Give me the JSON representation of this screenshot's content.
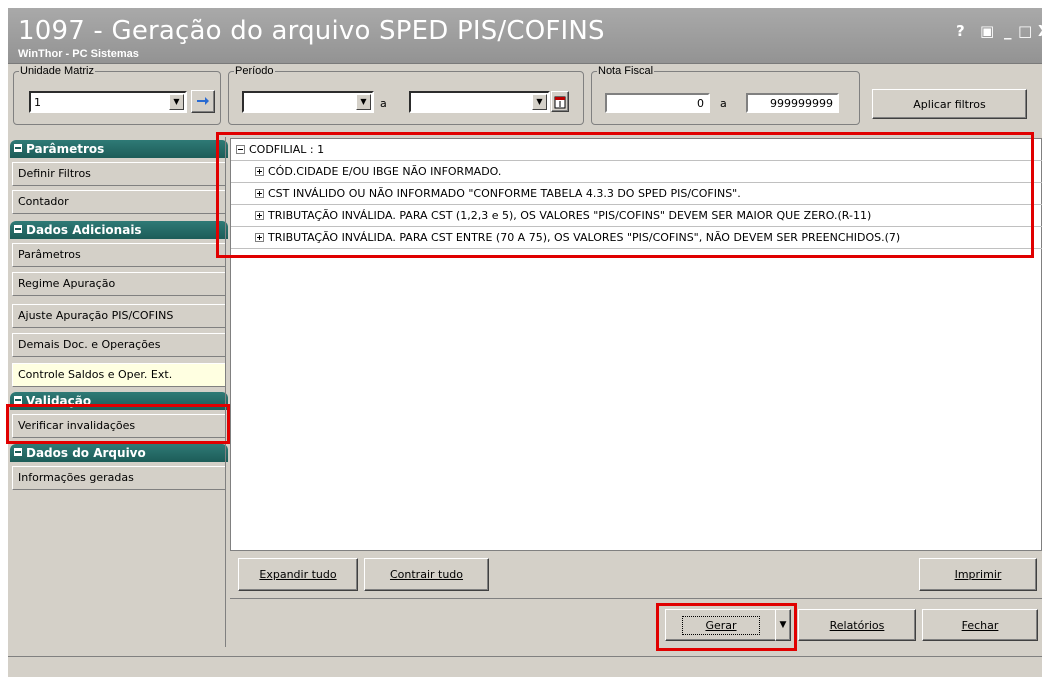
{
  "window": {
    "title": "1097 - Geração do arquivo SPED PIS/COFINS",
    "subtitle": "WinThor - PC Sistemas",
    "controls": [
      "?",
      "▣",
      "_",
      "□",
      "X"
    ]
  },
  "filters": {
    "unidade_matriz": {
      "label": "Unidade Matriz",
      "value": "1"
    },
    "periodo": {
      "label": "Período",
      "from": "",
      "to": "",
      "separator": "a"
    },
    "nota_fiscal": {
      "label": "Nota Fiscal",
      "from": "0",
      "to": "999999999",
      "separator": "a"
    },
    "apply_button": "Aplicar filtros"
  },
  "sidebar": {
    "sections": [
      {
        "title": "Parâmetros",
        "items": [
          "Definir Filtros",
          "Contador"
        ]
      },
      {
        "title": "Dados Adicionais",
        "items": [
          "Parâmetros",
          "Regime Apuração",
          "Ajuste Apuração PIS/COFINS",
          "Demais Doc. e Operações",
          "Controle Saldos e Oper. Ext."
        ]
      },
      {
        "title": "Validação",
        "items": [
          "Verificar invalidações"
        ]
      },
      {
        "title": "Dados do Arquivo",
        "items": [
          "Informações geradas"
        ]
      }
    ],
    "active_item": "Controle Saldos e Oper. Ext."
  },
  "tree": {
    "root": "CODFILIAL : 1",
    "children": [
      "CÓD.CIDADE E/OU IBGE NÃO INFORMADO.",
      "CST INVÁLIDO OU NÃO INFORMADO \"CONFORME TABELA 4.3.3 DO SPED PIS/COFINS\".",
      "TRIBUTAÇÃO INVÁLIDA. PARA CST (1,2,3 e 5), OS VALORES \"PIS/COFINS\" DEVEM SER MAIOR QUE ZERO.(R-11)",
      "TRIBUTAÇÃO INVÁLIDA. PARA CST ENTRE (70 A 75), OS VALORES \"PIS/COFINS\", NÃO DEVEM SER PREENCHIDOS.(7)"
    ]
  },
  "tree_buttons": {
    "expand": "Expandir tudo",
    "collapse": "Contrair tudo",
    "print": "Imprimir"
  },
  "footer_buttons": {
    "gerar": "Gerar",
    "relatorios": "Relatórios",
    "fechar": "Fechar"
  },
  "colors": {
    "highlight": "#e00000",
    "section_header": "#1d5c58",
    "title_bar": "#a0a0a0"
  }
}
